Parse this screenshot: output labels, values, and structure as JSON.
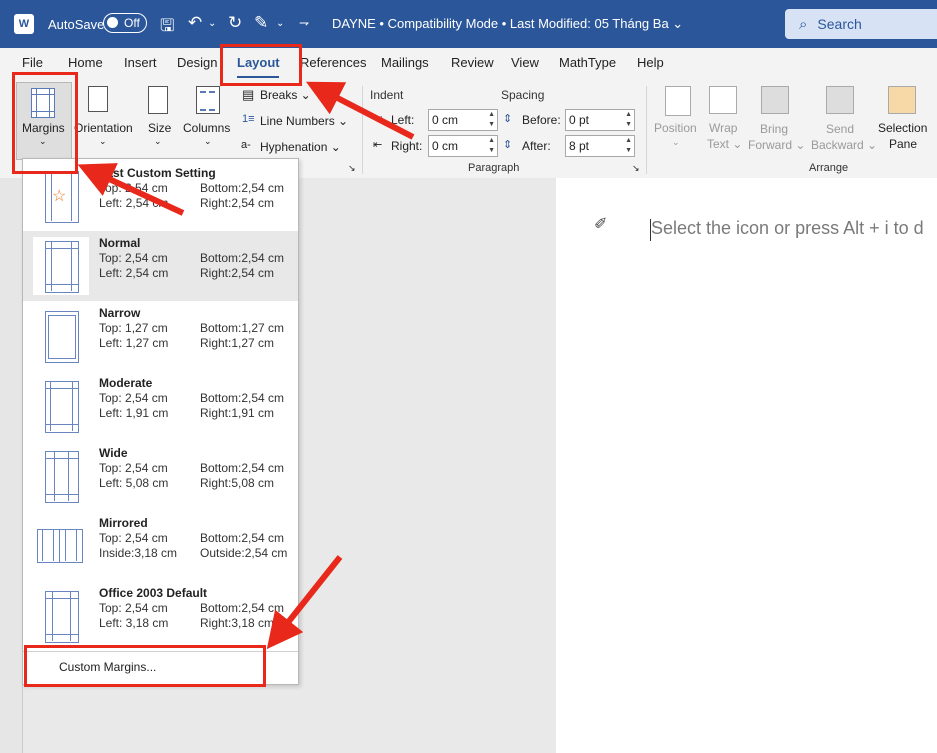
{
  "titlebar": {
    "logo": "W",
    "autosave_label": "AutoSave",
    "autosave_state": "Off",
    "doc_title": "DAYNE  •  Compatibility Mode  •  Last Modified: 05 Tháng Ba ⌄",
    "search_placeholder": "Search"
  },
  "tabs": [
    "File",
    "Home",
    "Insert",
    "Design",
    "Layout",
    "References",
    "Mailings",
    "Review",
    "View",
    "MathType",
    "Help"
  ],
  "active_tab": "Layout",
  "page_setup": {
    "margins": "Margins",
    "orientation": "Orientation",
    "size": "Size",
    "columns": "Columns",
    "breaks": "Breaks ⌄",
    "line_numbers": "Line Numbers ⌄",
    "hyphenation": "Hyphenation ⌄"
  },
  "paragraph": {
    "indent_label": "Indent",
    "spacing_label": "Spacing",
    "left_label": "Left:",
    "right_label": "Right:",
    "before_label": "Before:",
    "after_label": "After:",
    "left_value": "0 cm",
    "right_value": "0 cm",
    "before_value": "0 pt",
    "after_value": "8 pt",
    "group_label": "Paragraph"
  },
  "arrange": {
    "position": "Position",
    "wrap_text_1": "Wrap",
    "wrap_text_2": "Text ⌄",
    "bring_forward_1": "Bring",
    "bring_forward_2": "Forward ⌄",
    "send_backward_1": "Send",
    "send_backward_2": "Backward ⌄",
    "selection_pane_1": "Selection",
    "selection_pane_2": "Pane",
    "group_label": "Arrange"
  },
  "document": {
    "placeholder": "Select the icon or press Alt + i to d"
  },
  "margins_menu": [
    {
      "title": "Last Custom Setting",
      "top": "Top:  2,54 cm",
      "bottom": "Bottom:2,54 cm",
      "left": "Left:  2,54 cm",
      "right": "Right:2,54 cm"
    },
    {
      "title": "Normal",
      "top": "Top:  2,54 cm",
      "bottom": "Bottom:2,54 cm",
      "left": "Left:  2,54 cm",
      "right": "Right:2,54 cm"
    },
    {
      "title": "Narrow",
      "top": "Top:  1,27 cm",
      "bottom": "Bottom:1,27 cm",
      "left": "Left:  1,27 cm",
      "right": "Right:1,27 cm"
    },
    {
      "title": "Moderate",
      "top": "Top:  2,54 cm",
      "bottom": "Bottom:2,54 cm",
      "left": "Left:  1,91 cm",
      "right": "Right:1,91 cm"
    },
    {
      "title": "Wide",
      "top": "Top:  2,54 cm",
      "bottom": "Bottom:2,54 cm",
      "left": "Left:  5,08 cm",
      "right": "Right:5,08 cm"
    },
    {
      "title": "Mirrored",
      "top": "Top:  2,54 cm",
      "bottom": "Bottom:2,54 cm",
      "left": "Inside:3,18 cm",
      "right": "Outside:2,54 cm"
    },
    {
      "title": "Office 2003 Default",
      "top": "Top:  2,54 cm",
      "bottom": "Bottom:2,54 cm",
      "left": "Left:  3,18 cm",
      "right": "Right:3,18 cm"
    }
  ],
  "custom_margins": "Custom Margins...",
  "colors": {
    "brand": "#2b579a",
    "annotation": "#e8281a"
  }
}
